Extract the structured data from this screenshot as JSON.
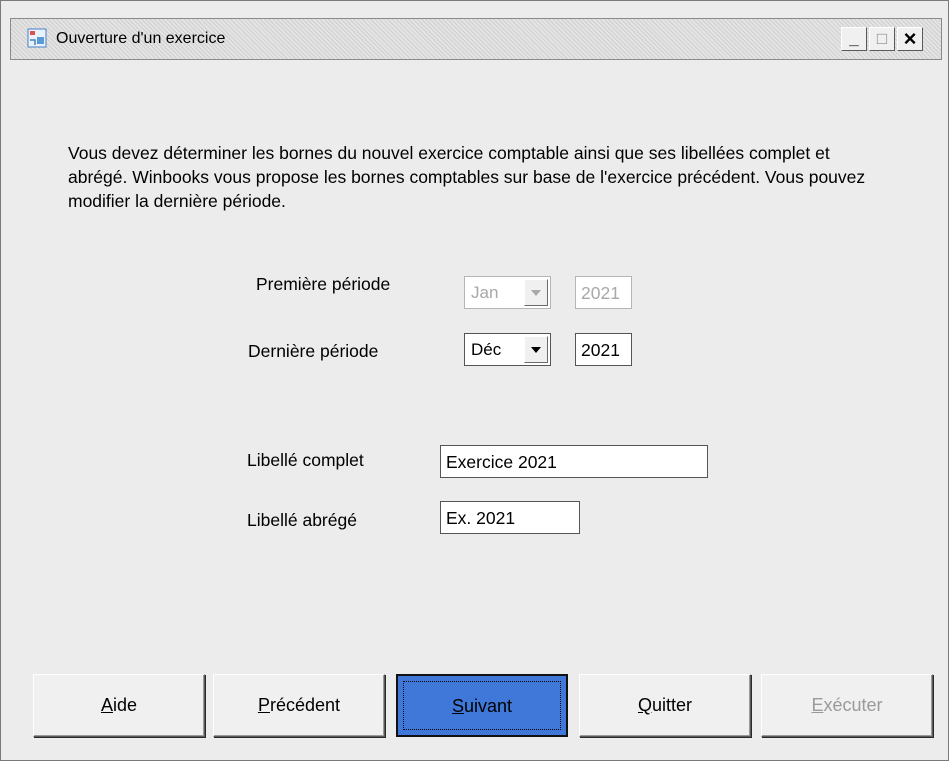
{
  "window": {
    "title": "Ouverture d'un exercice",
    "controls": {
      "minimize": "_",
      "maximize": "□",
      "close": "×"
    }
  },
  "intro_text": "Vous devez déterminer les bornes du nouvel exercice comptable ainsi que ses libellées complet et abrégé. Winbooks vous propose les bornes comptables sur base de l'exercice précédent. Vous pouvez modifier la dernière période.",
  "first_period": {
    "label": "Première période",
    "month": "Jan",
    "year": "2021",
    "enabled": false
  },
  "last_period": {
    "label": "Dernière période",
    "month": "Déc",
    "year": "2021",
    "enabled": true
  },
  "full_label": {
    "label": "Libellé complet",
    "value": "Exercice 2021"
  },
  "short_label": {
    "label": "Libellé abrégé",
    "value": "Ex. 2021"
  },
  "buttons": {
    "help": {
      "mnemonic": "A",
      "rest": "ide"
    },
    "previous": {
      "mnemonic": "P",
      "rest": "récédent"
    },
    "next": {
      "mnemonic": "S",
      "rest": "uivant"
    },
    "quit": {
      "mnemonic": "Q",
      "rest": "uitter"
    },
    "execute": {
      "mnemonic": "E",
      "rest": "xécuter",
      "enabled": false
    }
  },
  "colors": {
    "primary_button": "#3f78d9",
    "window_bg": "#ececec"
  }
}
